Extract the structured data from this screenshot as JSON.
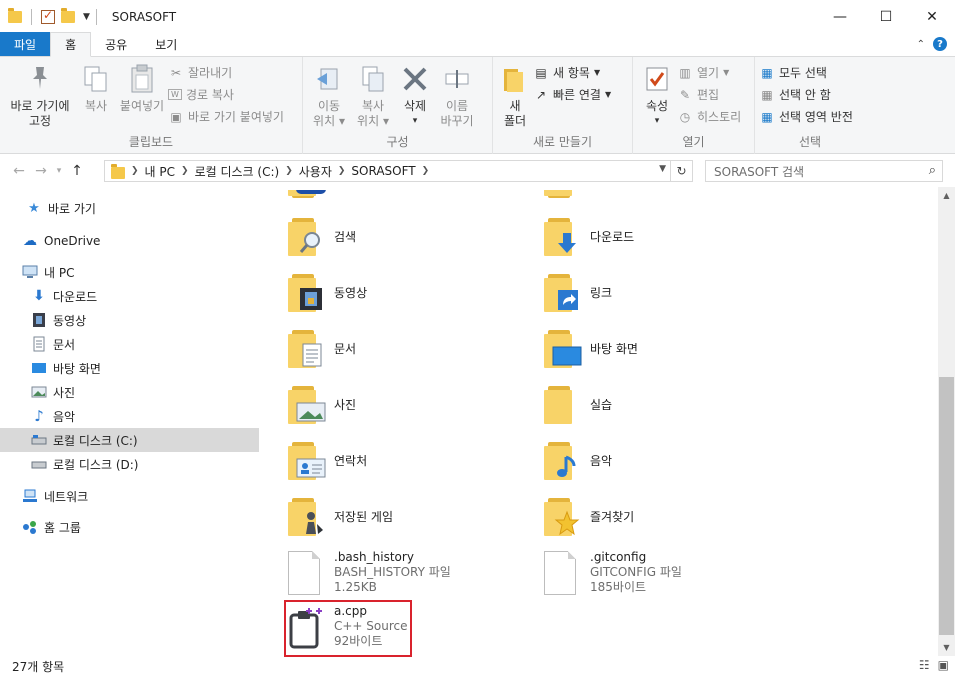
{
  "window": {
    "title": "SORASOFT",
    "controls": {
      "minimize": "—",
      "maximize": "☐",
      "close": "✕"
    }
  },
  "ribbon_tabs": [
    "파일",
    "홈",
    "공유",
    "보기"
  ],
  "ribbon": {
    "clipboard": {
      "label": "클립보드",
      "pin": [
        "바로 가기에",
        "고정"
      ],
      "copy": "복사",
      "paste": "붙여넣기",
      "cut": "잘라내기",
      "copy_path": "경로 복사",
      "paste_shortcut": "바로 가기 붙여넣기"
    },
    "organize": {
      "label": "구성",
      "move": [
        "이동",
        "위치"
      ],
      "copyto": [
        "복사",
        "위치"
      ],
      "delete": "삭제",
      "rename": [
        "이름",
        "바꾸기"
      ]
    },
    "new": {
      "label": "새로 만들기",
      "new_folder": [
        "새",
        "폴더"
      ],
      "new_item": "새 항목",
      "easy_access": "빠른 연결"
    },
    "open": {
      "label": "열기",
      "properties": "속성",
      "open": "열기",
      "edit": "편집",
      "history": "히스토리"
    },
    "select": {
      "label": "선택",
      "select_all": "모두 선택",
      "select_none": "선택 안 함",
      "invert": "선택 영역 반전"
    }
  },
  "address": {
    "crumbs": [
      "내 PC",
      "로컬 디스크 (C:)",
      "사용자",
      "SORASOFT"
    ],
    "search_placeholder": "SORASOFT 검색"
  },
  "nav": [
    {
      "label": "바로 가기",
      "icon": "star-icon"
    },
    {
      "label": "OneDrive",
      "icon": "cloud-icon"
    },
    {
      "label": "내 PC",
      "icon": "pc-icon"
    },
    {
      "label": "다운로드",
      "icon": "download-icon"
    },
    {
      "label": "동영상",
      "icon": "video-icon"
    },
    {
      "label": "문서",
      "icon": "document-icon"
    },
    {
      "label": "바탕 화면",
      "icon": "desktop-icon"
    },
    {
      "label": "사진",
      "icon": "pictures-icon"
    },
    {
      "label": "음악",
      "icon": "music-icon"
    },
    {
      "label": "로컬 디스크 (C:)",
      "icon": "drive-icon"
    },
    {
      "label": "로컬 디스크 (D:)",
      "icon": "drive-icon"
    },
    {
      "label": "네트워크",
      "icon": "network-icon"
    },
    {
      "label": "홈 그룹",
      "icon": "homegroup-icon"
    }
  ],
  "items": [
    {
      "name": "검색",
      "icon": "search-icon"
    },
    {
      "name": "다운로드",
      "icon": "download-icon"
    },
    {
      "name": "동영상",
      "icon": "video-icon"
    },
    {
      "name": "링크",
      "icon": "link-icon"
    },
    {
      "name": "문서",
      "icon": "document-icon"
    },
    {
      "name": "바탕 화면",
      "icon": "desktop-icon"
    },
    {
      "name": "사진",
      "icon": "pictures-icon"
    },
    {
      "name": "실습",
      "icon": "folder-icon"
    },
    {
      "name": "연락처",
      "icon": "contacts-icon"
    },
    {
      "name": "음악",
      "icon": "music-icon"
    },
    {
      "name": "저장된 게임",
      "icon": "games-icon"
    },
    {
      "name": "즐겨찾기",
      "icon": "favorites-icon"
    }
  ],
  "files": [
    {
      "name": ".bash_history",
      "type": "BASH_HISTORY 파일",
      "size": "1.25KB"
    },
    {
      "name": ".gitconfig",
      "type": "GITCONFIG 파일",
      "size": "185바이트"
    },
    {
      "name": "a.cpp",
      "type": "C++ Source",
      "size": "92바이트"
    }
  ],
  "status": {
    "count": "27개 항목"
  },
  "colors": {
    "accent": "#1979ca",
    "selection_highlight": "#d9232d",
    "folder": "#f8d368"
  }
}
